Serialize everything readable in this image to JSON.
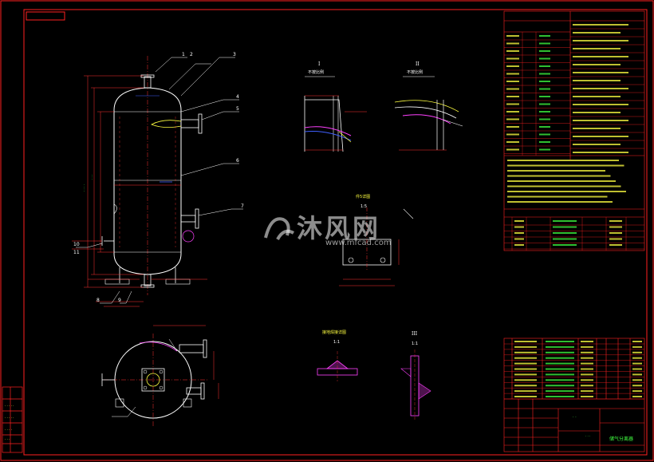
{
  "drawing": {
    "title_block": {
      "product_name": "储气分离器"
    },
    "view_labels": {
      "detail_1_numeral": "I",
      "detail_1_scale": "不按比例",
      "detail_2_numeral": "II",
      "detail_2_scale": "不按比例",
      "support_view_title": "件5详图",
      "support_view_scale": "1:5",
      "weld_detail_title": "接地焊接详图",
      "weld_detail_scale": "1:1",
      "detail_3_numeral": "III",
      "detail_3_scale": "1:1"
    },
    "leader_numbers": [
      "1",
      "2",
      "3",
      "4",
      "5",
      "6",
      "7",
      "8",
      "9",
      "10",
      "11"
    ],
    "watermark": {
      "brand": "沐风网",
      "url": "www.mfcad.com"
    }
  },
  "colors": {
    "background": "#000000",
    "frame": "#ff2020",
    "outline": "#ffffff",
    "dimension": "#ff3030",
    "centerline": "#ff3030",
    "text_yellow": "#ffff40",
    "text_green": "#40ff40",
    "magenta": "#ff40ff",
    "blue": "#4060ff",
    "cyan": "#40e0e0"
  }
}
